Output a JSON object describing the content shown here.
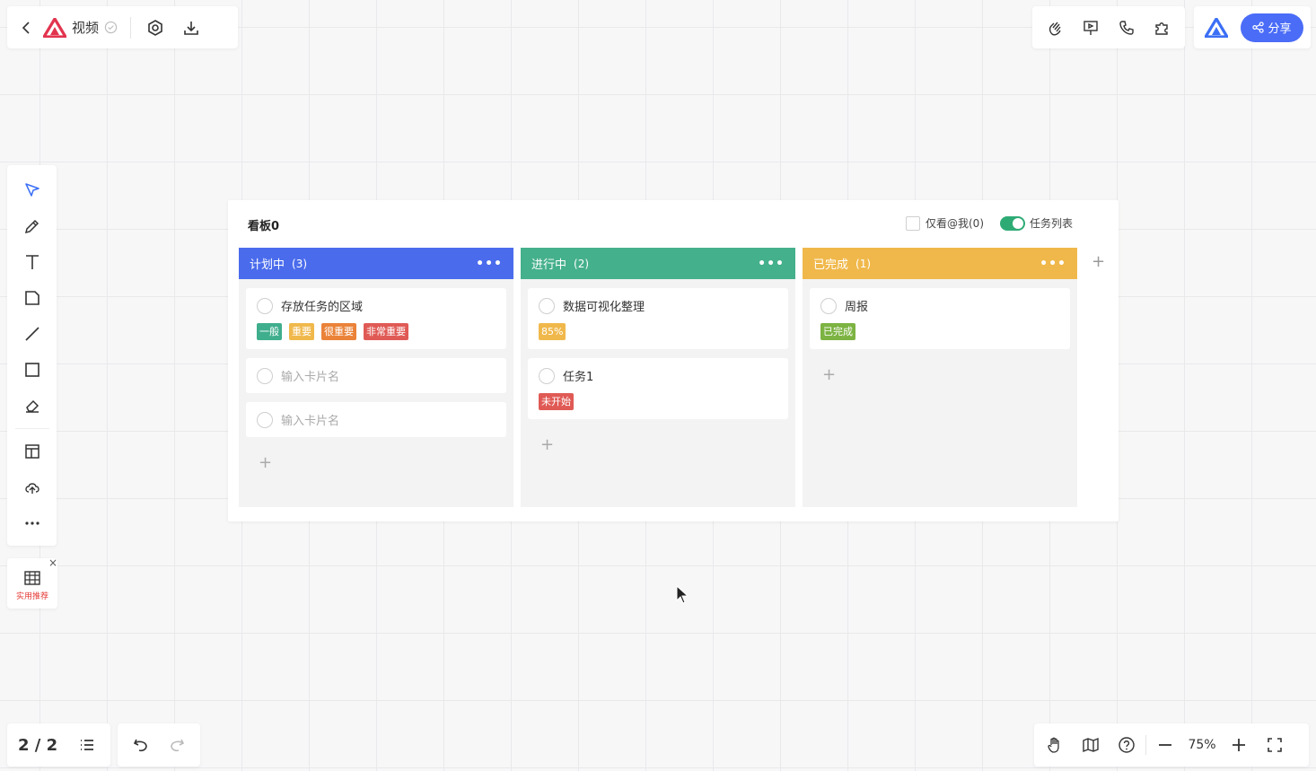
{
  "header": {
    "title": "视频",
    "share_label": "分享"
  },
  "toolbar_left": [
    "select-tool",
    "pen-tool",
    "text-tool",
    "sticky-note-tool",
    "line-tool",
    "rectangle-tool",
    "eraser-tool",
    "template-tool",
    "upload-tool",
    "more-tool"
  ],
  "recommend": {
    "label": "实用推荐"
  },
  "pager": {
    "text": "2 / 2"
  },
  "zoom": {
    "level": "75%"
  },
  "colors": {
    "accent": "#4a6cf7",
    "planning": "#4a6cec",
    "inprogress": "#45b08c",
    "done": "#f0b84b"
  },
  "kanban": {
    "title": "看板0",
    "only_me_label": "仅看@我(0)",
    "task_list_label": "任务列表",
    "columns": [
      {
        "name": "计划中",
        "count": "(3)",
        "color": "#4a6cec",
        "cards": [
          {
            "name": "存放任务的区域",
            "tags": [
              {
                "text": "一般",
                "color": "#3fae8c"
              },
              {
                "text": "重要",
                "color": "#f0b84b"
              },
              {
                "text": "很重要",
                "color": "#ea8238"
              },
              {
                "text": "非常重要",
                "color": "#e05a55"
              }
            ]
          },
          {
            "placeholder": "输入卡片名"
          },
          {
            "placeholder": "输入卡片名"
          }
        ]
      },
      {
        "name": "进行中",
        "count": "(2)",
        "color": "#45b08c",
        "cards": [
          {
            "name": "数据可视化整理",
            "tags": [
              {
                "text": "85%",
                "color": "#f0b84b"
              }
            ]
          },
          {
            "name": "任务1",
            "tags": [
              {
                "text": "未开始",
                "color": "#e05a55"
              }
            ]
          }
        ]
      },
      {
        "name": "已完成",
        "count": "(1)",
        "color": "#f0b84b",
        "cards": [
          {
            "name": "周报",
            "tags": [
              {
                "text": "已完成",
                "color": "#7cb342"
              }
            ]
          }
        ]
      }
    ]
  }
}
